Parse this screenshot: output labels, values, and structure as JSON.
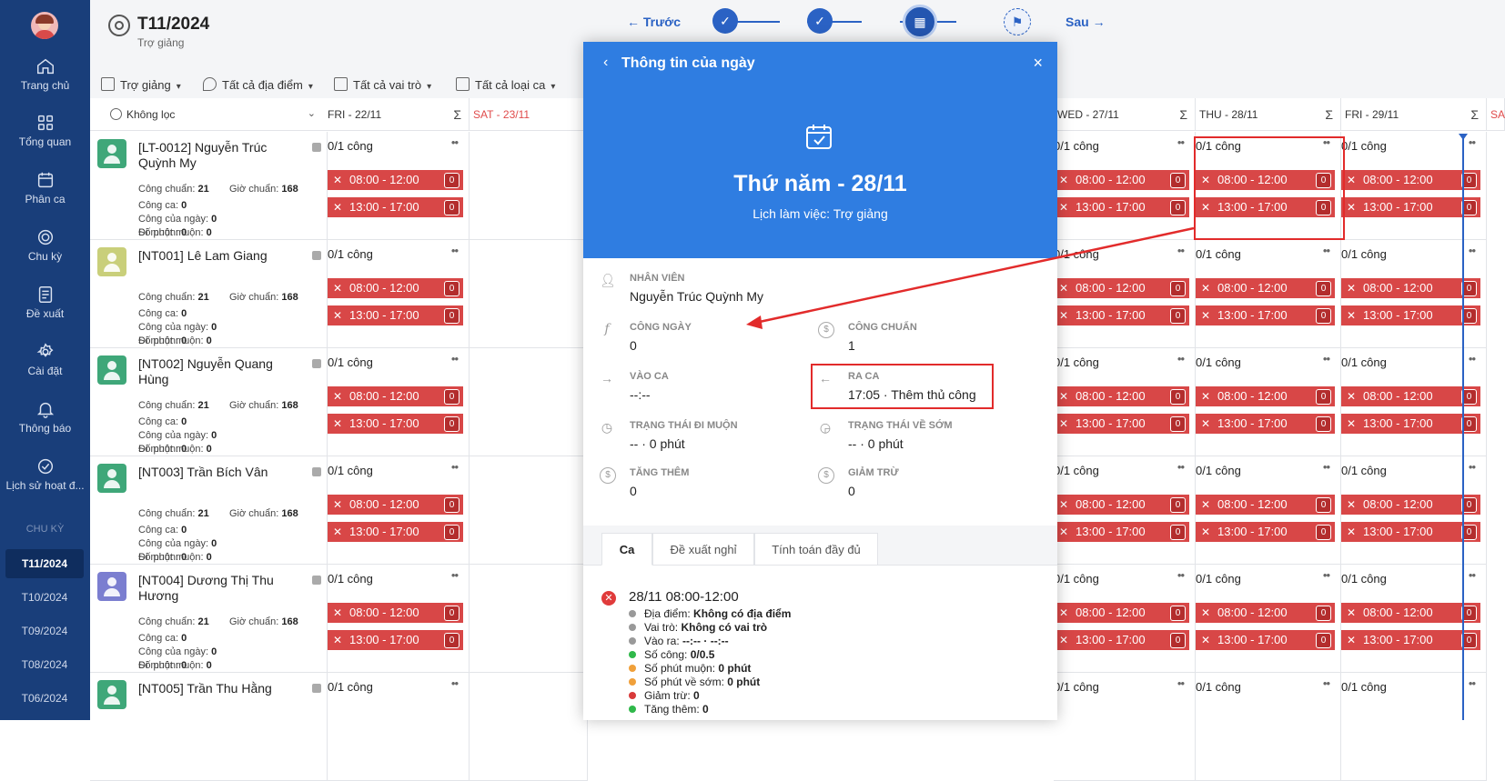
{
  "sidebar": {
    "items": [
      {
        "label": "Trang chủ",
        "icon": "home-icon"
      },
      {
        "label": "Tổng quan",
        "icon": "grid-icon"
      },
      {
        "label": "Phân ca",
        "icon": "calendar-icon"
      },
      {
        "label": "Chu kỳ",
        "icon": "cycle-icon"
      },
      {
        "label": "Đề xuất",
        "icon": "document-icon"
      },
      {
        "label": "Cài đặt",
        "icon": "gear-icon"
      },
      {
        "label": "Thông báo",
        "icon": "bell-icon"
      },
      {
        "label": "Lịch sử hoạt đ...",
        "icon": "check-circle-icon"
      }
    ],
    "section_label": "CHU KỲ",
    "periods": [
      "T11/2024",
      "T10/2024",
      "T09/2024",
      "T08/2024",
      "T06/2024"
    ],
    "active_period": "T11/2024"
  },
  "header": {
    "title": "T11/2024",
    "subtitle": "Trợ giảng",
    "prev": "← Trước",
    "next": "Sau →"
  },
  "filters": [
    {
      "label": "Trợ giảng"
    },
    {
      "label": "Tất cả địa điểm"
    },
    {
      "label": "Tất cả vai trò"
    },
    {
      "label": "Tất cả loại ca"
    }
  ],
  "grid": {
    "filter_label": "Không lọc",
    "columns": [
      {
        "label": "FRI - 22/11",
        "sum": "Σ"
      },
      {
        "label": "SAT - 23/11",
        "sum": ""
      },
      {
        "label": "WED - 27/11",
        "sum": "Σ"
      },
      {
        "label": "THU - 28/11",
        "sum": "Σ"
      },
      {
        "label": "FRI - 29/11",
        "sum": "Σ"
      },
      {
        "label": "SA",
        "sum": ""
      }
    ],
    "cong_text": "0/1 công",
    "shift_morning": "08:00 - 12:00",
    "shift_afternoon": "13:00 - 17:00",
    "shift_count": "0",
    "meta_labels": {
      "cong_chuan": "Công chuẩn:",
      "gio_chuan": "Giờ chuẩn:",
      "cong_ca": "Công ca:",
      "cong_ngay": "Công của ngày:",
      "di_muon": "Đi muộn:",
      "phut_muon": "Số phút muộn:"
    },
    "employees": [
      {
        "name": "[LT-0012] Nguyễn Trúc Quỳnh My",
        "cong_chuan": "21",
        "gio_chuan": "168",
        "cong_ca": "0",
        "cong_ngay": "0",
        "di_muon": "0",
        "phut_muon": "0",
        "color": "#3fa779"
      },
      {
        "name": "[NT001] Lê Lam Giang",
        "cong_chuan": "21",
        "gio_chuan": "168",
        "cong_ca": "0",
        "cong_ngay": "0",
        "di_muon": "0",
        "phut_muon": "0",
        "color": "#c9cf7a"
      },
      {
        "name": "[NT002] Nguyễn Quang Hùng",
        "cong_chuan": "21",
        "gio_chuan": "168",
        "cong_ca": "0",
        "cong_ngay": "0",
        "di_muon": "0",
        "phut_muon": "0",
        "color": "#3fa779"
      },
      {
        "name": "[NT003] Trần Bích Vân",
        "cong_chuan": "21",
        "gio_chuan": "168",
        "cong_ca": "0",
        "cong_ngay": "0",
        "di_muon": "0",
        "phut_muon": "0",
        "color": "#3fa779"
      },
      {
        "name": "[NT004] Dương Thị Thu Hương",
        "cong_chuan": "21",
        "gio_chuan": "168",
        "cong_ca": "0",
        "cong_ngay": "0",
        "di_muon": "0",
        "phut_muon": "0",
        "color": "#7b7ed0"
      },
      {
        "name": "[NT005] Trần Thu Hằng",
        "cong_chuan": "",
        "gio_chuan": "",
        "cong_ca": "",
        "cong_ngay": "",
        "di_muon": "",
        "phut_muon": "",
        "color": "#3fa779"
      }
    ]
  },
  "modal": {
    "back": "‹",
    "title": "Thông tin của ngày",
    "close": "×",
    "date": "Thứ năm - 28/11",
    "schedule": "Lịch làm việc: Trợ giảng",
    "fields": {
      "nhan_vien": {
        "label": "NHÂN VIÊN",
        "value": "Nguyễn Trúc Quỳnh My"
      },
      "cong_ngay": {
        "label": "CÔNG NGÀY",
        "value": "0"
      },
      "cong_chuan": {
        "label": "CÔNG CHUẨN",
        "value": "1"
      },
      "vao_ca": {
        "label": "VÀO CA",
        "value": "--:--"
      },
      "ra_ca": {
        "label": "RA CA",
        "value": "17:05 · Thêm thủ công"
      },
      "di_muon": {
        "label": "TRẠNG THÁI ĐI MUỘN",
        "value": "-- · 0 phút"
      },
      "ve_som": {
        "label": "TRẠNG THÁI VỀ SỚM",
        "value": "-- · 0 phút"
      },
      "tang_them": {
        "label": "TĂNG THÊM",
        "value": "0"
      },
      "giam_tru": {
        "label": "GIẢM TRỪ",
        "value": "0"
      }
    },
    "tabs": [
      "Ca",
      "Đề xuất nghỉ",
      "Tính toán đầy đủ"
    ],
    "entry": {
      "title": "28/11 08:00-12:00",
      "lines": [
        {
          "label": "Địa điểm:",
          "value": "Không có địa điểm",
          "color": "#999999"
        },
        {
          "label": "Vai trò:",
          "value": "Không có vai trò",
          "color": "#999999"
        },
        {
          "label": "Vào ra:",
          "value": "--:-- · --:--",
          "color": "#999999"
        },
        {
          "label": "Số công:",
          "value": "0/0.5",
          "color": "#2fb84a"
        },
        {
          "label": "Số phút muộn:",
          "value": "0 phút",
          "color": "#f0a03a"
        },
        {
          "label": "Số phút về sớm:",
          "value": "0 phút",
          "color": "#f0a03a"
        },
        {
          "label": "Giảm trừ:",
          "value": "0",
          "color": "#d83a3a"
        },
        {
          "label": "Tăng thêm:",
          "value": "0",
          "color": "#2fb84a"
        }
      ]
    }
  }
}
